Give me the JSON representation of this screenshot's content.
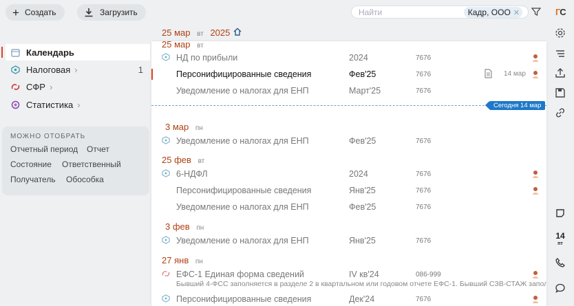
{
  "toolbar": {
    "create_label": "Создать",
    "upload_label": "Загрузить"
  },
  "search": {
    "placeholder": "Найти",
    "chip": "Кадр, ООО"
  },
  "logo": {
    "text_a": "Г",
    "text_b": "С"
  },
  "nav": [
    {
      "label": "Календарь",
      "icon": "calendar-icon"
    },
    {
      "label": "Налоговая",
      "icon": "tax-icon",
      "count": "1"
    },
    {
      "label": "СФР",
      "icon": "sfr-icon"
    },
    {
      "label": "Статистика",
      "icon": "stats-icon"
    }
  ],
  "filters": {
    "title": "МОЖНО ОТОБРАТЬ",
    "items": [
      "Отчетный период",
      "Отчет",
      "Состояние",
      "Ответственный",
      "Получатель",
      "Обособка"
    ]
  },
  "header": {
    "day": "25",
    "month": "мар",
    "weekday": "вт",
    "year": "2025"
  },
  "today_label": "Сегодня 14 мар",
  "groups": [
    {
      "day": "25",
      "month": "мар",
      "weekday": "вт"
    },
    {
      "day": "3",
      "month": "мар",
      "weekday": "пн"
    },
    {
      "day": "25",
      "month": "фев",
      "weekday": "вт"
    },
    {
      "day": "3",
      "month": "фев",
      "weekday": "пн"
    },
    {
      "day": "27",
      "month": "янв",
      "weekday": "пн"
    }
  ],
  "rows": [
    {
      "name": "НД по прибыли",
      "period": "2024",
      "code": "7676"
    },
    {
      "name": "Персонифицированные сведения",
      "period": "Фев'25",
      "code": "7676",
      "date": "14 мар"
    },
    {
      "name": "Уведомление о налогах для ЕНП",
      "period": "Март'25",
      "code": "7676"
    },
    {
      "name": "Уведомление о налогах для ЕНП",
      "period": "Фев'25",
      "code": "7676"
    },
    {
      "name": "6-НДФЛ",
      "period": "2024",
      "code": "7676"
    },
    {
      "name": "Персонифицированные сведения",
      "period": "Янв'25",
      "code": "7676"
    },
    {
      "name": "Уведомление о налогах для ЕНП",
      "period": "Фев'25",
      "code": "7676"
    },
    {
      "name": "Уведомление о налогах для ЕНП",
      "period": "Янв'25",
      "code": "7676"
    },
    {
      "name": "ЕФС-1 Единая форма сведений",
      "period": "IV кв'24",
      "code": "086-999"
    },
    {
      "name": "Персонифицированные сведения",
      "period": "Дек'24",
      "code": "7676"
    }
  ],
  "efs_note": "Бывший 4-ФСС заполняется в разделе 2 в квартальном или годовом отчете ЕФС-1. Бывший СЗВ-СТАЖ заполня...",
  "right_bar": {
    "calendar_day": "14",
    "calendar_unit": "пт"
  },
  "colors": {
    "accent": "#b04010",
    "today": "#1e78c8",
    "active_mark": "#e04020"
  }
}
